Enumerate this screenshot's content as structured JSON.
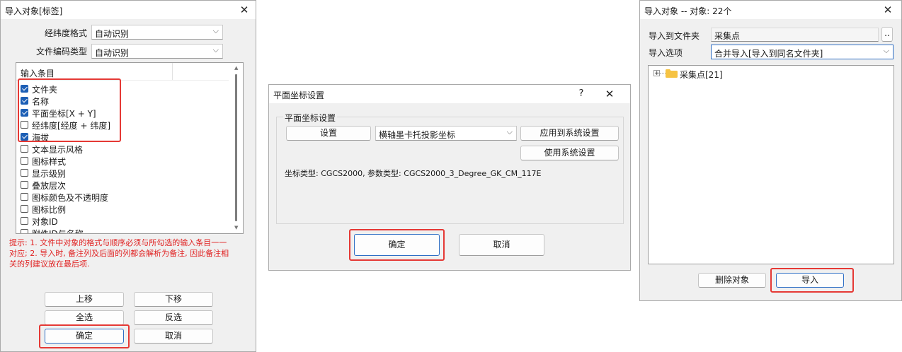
{
  "dialog1": {
    "title": "导入对象[标签]",
    "close": "✕",
    "latlon_format_label": "经纬度格式",
    "latlon_format_value": "自动识别",
    "file_encoding_label": "文件编码类型",
    "file_encoding_value": "自动识别",
    "list_header": "输入条目",
    "items": [
      {
        "label": "文件夹",
        "checked": true
      },
      {
        "label": "名称",
        "checked": true
      },
      {
        "label": "平面坐标[X + Y]",
        "checked": true
      },
      {
        "label": "经纬度[经度 + 纬度]",
        "checked": false
      },
      {
        "label": "海拔",
        "checked": true
      },
      {
        "label": "文本显示风格",
        "checked": false
      },
      {
        "label": "图标样式",
        "checked": false
      },
      {
        "label": "显示级别",
        "checked": false
      },
      {
        "label": "叠放层次",
        "checked": false
      },
      {
        "label": "图标颜色及不透明度",
        "checked": false
      },
      {
        "label": "图标比例",
        "checked": false
      },
      {
        "label": "对象ID",
        "checked": false
      },
      {
        "label": "附件ID与名称",
        "checked": false
      }
    ],
    "hint_lines": [
      "提示: 1. 文件中对象的格式与顺序必须与所勾选的输入条目一一",
      "对应; 2. 导入时, 备注列及后面的列都会解析为备注, 因此备注相",
      "关的列建议放在最后项."
    ],
    "move_up": "上移",
    "move_down": "下移",
    "select_all": "全选",
    "invert_select": "反选",
    "ok": "确定",
    "cancel": "取消"
  },
  "dialog2": {
    "title": "平面坐标设置",
    "help": "?",
    "close": "✕",
    "group_title": "平面坐标设置",
    "settings_button": "设置",
    "projection_value": "横轴墨卡托投影坐标",
    "apply_system": "应用到系统设置",
    "use_system": "使用系统设置",
    "info": "坐标类型: CGCS2000, 参数类型: CGCS2000_3_Degree_GK_CM_117E",
    "ok": "确定",
    "cancel": "取消"
  },
  "dialog3": {
    "title": "导入对象 -- 对象: 22个",
    "close": "✕",
    "import_to_label": "导入到文件夹",
    "import_to_value": "采集点",
    "browse": "..",
    "options_label": "导入选项",
    "options_value": "合并导入[导入到同名文件夹]",
    "tree_item": "采集点[21]",
    "tree_expander": "+",
    "delete_button": "删除对象",
    "import_button": "导入"
  },
  "colors": {
    "highlight_box": "#e53935",
    "hint_text": "#e02020",
    "checkbox_checked": "#1d5fb5",
    "folder": "#f6c343",
    "primary_border": "#2f6fc5"
  }
}
